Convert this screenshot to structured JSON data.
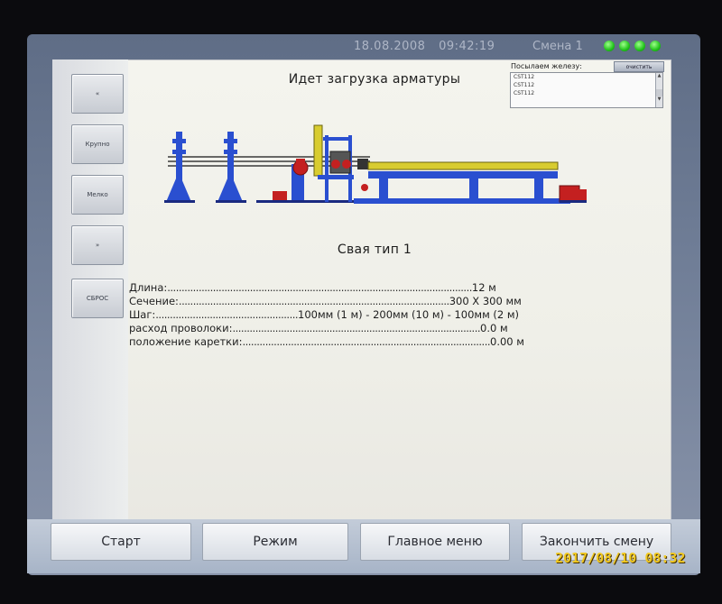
{
  "header": {
    "datetime": "18.08.2008   09:42:19",
    "shift": "Смена 1",
    "status_leds": 4,
    "led_color": "#22c41c"
  },
  "title": "Идет загрузка арматуры",
  "send_panel": {
    "label": "Посылаем железу:",
    "clear_label": "очистить",
    "items": [
      "CST112",
      "CST112",
      "CST112"
    ]
  },
  "side_buttons": [
    {
      "label": "«",
      "icon": "double-left-arrow-icon"
    },
    {
      "label": "Крупно"
    },
    {
      "label": "Мелко"
    },
    {
      "label": "»",
      "icon": "double-right-arrow-icon"
    },
    {
      "label": "СБРОС"
    }
  ],
  "pile_type": "Свая тип 1",
  "params": [
    {
      "label": "Длина:",
      "dots": "...........................................................................................................",
      "value": "12 м"
    },
    {
      "label": "Сечение:",
      "dots": "...............................................................................................",
      "value": "300 X 300 мм"
    },
    {
      "label": "Шаг:",
      "dots": "..................................................",
      "value": "100мм (1 м) - 200мм (10 м) - 100мм (2 м)"
    },
    {
      "label": "расход проволоки:",
      "dots": ".......................................................................................",
      "value": "0.0 м"
    },
    {
      "label": "положение каретки:",
      "dots": ".......................................................................................",
      "value": "0.00 м"
    }
  ],
  "bottom_buttons": [
    {
      "label": "Старт"
    },
    {
      "label": "Режим"
    },
    {
      "label": "Главное меню"
    },
    {
      "label": "Закончить смену"
    }
  ],
  "camera_timestamp": "2017/08/10 08:32",
  "colors": {
    "machine_frame": "#2a4fd0",
    "rail": "#d8cc30",
    "motor": "#c42020"
  }
}
